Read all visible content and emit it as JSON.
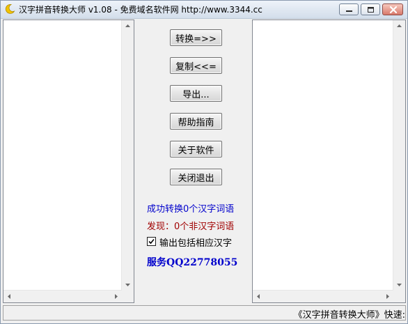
{
  "window": {
    "title": "汉字拼音转换大师 v1.08 - 免费域名软件网 http://www.3344.cc"
  },
  "buttons": {
    "convert": "转换=>>",
    "copy": "复制<<=",
    "export": "导出...",
    "help": "帮助指南",
    "about": "关于软件",
    "exit": "关闭退出"
  },
  "status": {
    "converted": "成功转换0个汉字词语",
    "found": "发现：0个非汉字词语"
  },
  "options": {
    "include_hanzi_label": "输出包括相应汉字",
    "include_hanzi_checked": true
  },
  "service": "服务QQ22778055",
  "statusbar": {
    "text": "《汉字拼音转换大师》快速:"
  },
  "colors": {
    "status_blue": "#0000cc",
    "status_red": "#a00000",
    "title_bg": "#dfe7f1"
  }
}
